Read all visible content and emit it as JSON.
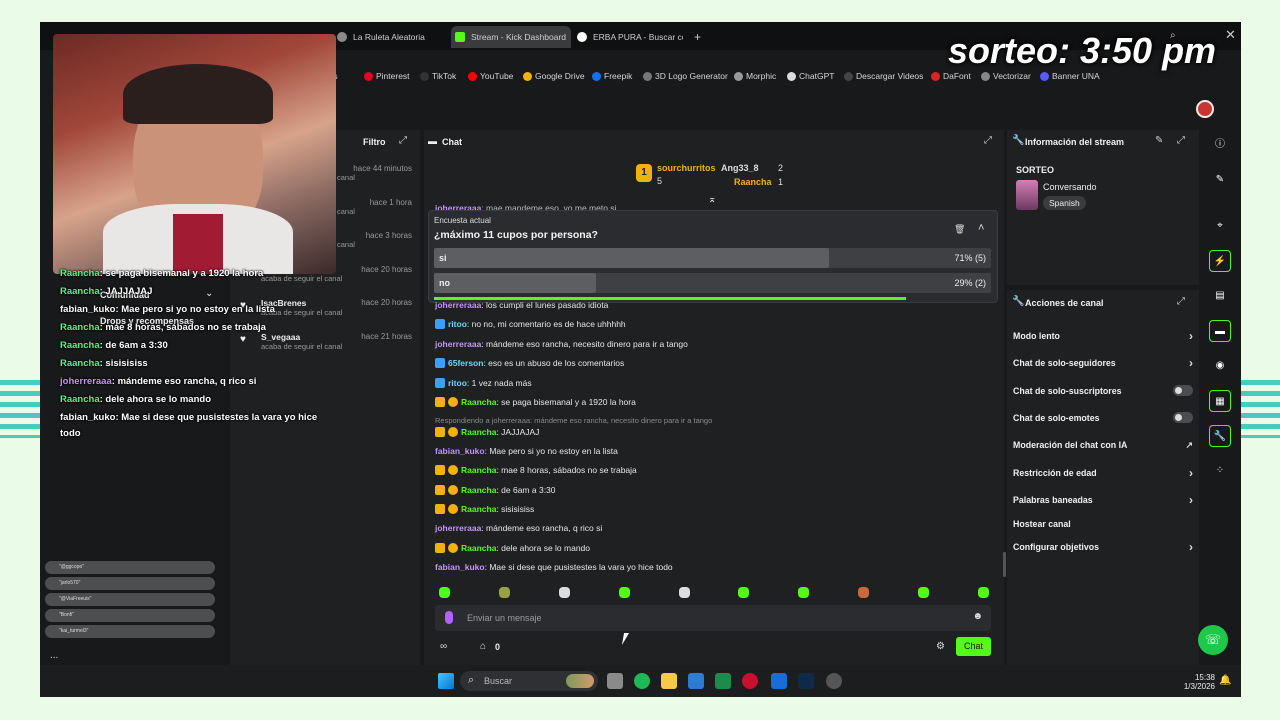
{
  "overlay": {
    "title": "sorteo: 3:50 pm"
  },
  "browser": {
    "tabs": [
      {
        "label": "La Ruleta Aleatoria"
      },
      {
        "label": "Stream - Kick Dashboard"
      },
      {
        "label": "ERBA PURA - Buscar con"
      }
    ],
    "new_tab": "+",
    "bookmarks": [
      "ales",
      "Pinterest",
      "TikTok",
      "YouTube",
      "Google Drive",
      "Freepik",
      "3D Logo Generator",
      "Morphic",
      "ChatGPT",
      "Descargar Videos",
      "DaFont",
      "Vectorizar",
      "Banner UNA"
    ]
  },
  "left_panel": {
    "filter_label": "Filtro",
    "community": "Comunidad",
    "drops": "Drops y recompensas",
    "events": [
      {
        "time": "hace 44 minutos",
        "user": "",
        "action": "canal"
      },
      {
        "time": "hace 1 hora",
        "user": "",
        "action": "canal"
      },
      {
        "time": "hace 3 horas",
        "user": "",
        "action": "canal"
      },
      {
        "time": "hace 20 horas",
        "user": "",
        "action": "acaba de seguir el canal"
      },
      {
        "time": "hace 20 horas",
        "user": "IsacBrenes",
        "action": "acaba de seguir el canal"
      },
      {
        "time": "hace 21 horas",
        "user": "S_vegaaa",
        "action": "acaba de seguir el canal"
      }
    ],
    "overlay_chat": [
      {
        "user": "Raancha",
        "text": ": se paga bisemanal y a 1920 la hora"
      },
      {
        "user": "Raancha",
        "text": ": JAJJAJAJ"
      },
      {
        "user": "fabian_kuko",
        "text": ": Mae pero si yo no estoy en la lista"
      },
      {
        "user": "Raancha",
        "text": ": mae 8 horas, sábados no se trabaja"
      },
      {
        "user": "Raancha",
        "text": ": de 6am a 3:30"
      },
      {
        "user": "Raancha",
        "text": ": sisisisiss"
      },
      {
        "user": "joherreraaa",
        "text": ": mándeme eso rancha, q rico si"
      },
      {
        "user": "Raancha",
        "text": ": dele ahora se lo mando"
      },
      {
        "user": "fabian_kuko",
        "text": ": Mae si dese que pusistestes la vara yo hice"
      },
      {
        "user": "",
        "text": "todo"
      }
    ],
    "giveaway_entries": [
      "\"@ggcopo\"",
      "\"jarlo570\"",
      "\"@ViaFreeuis\"",
      "\"Bonfi\"",
      "\"kai_turmel3\""
    ],
    "more": "..."
  },
  "chat": {
    "title": "Chat",
    "leaderboard": [
      {
        "rank": "1",
        "name": "sourchurritos",
        "count": "5"
      },
      {
        "rank": "",
        "name": "Ang33_8",
        "count": "2"
      },
      {
        "rank": "",
        "name": "Raancha",
        "count": "1"
      }
    ],
    "poll": {
      "heading": "Encuesta actual",
      "question": "¿máximo 11 cupos por persona?",
      "options": [
        {
          "label": "si",
          "result": "71% (5)",
          "percent": 71
        },
        {
          "label": "no",
          "result": "29% (2)",
          "percent": 29
        }
      ]
    },
    "messages": [
      {
        "user": "joherreraaa",
        "text": ": mae mandeme eso, yo me meto si"
      },
      {
        "user": "joherreraaa",
        "text": ": los cumpli el lunes pasado idiota"
      },
      {
        "user": "ritoo",
        "text": ": no no, mi comentario es de hace uhhhhh"
      },
      {
        "user": "joherreraaa",
        "text": ": mándeme eso rancha, necesito dinero para ir a tango"
      },
      {
        "user": "65ferson",
        "text": ": eso es un abuso de los comentarios"
      },
      {
        "user": "ritoo",
        "text": ": 1 vez nada más"
      },
      {
        "user": "Raancha",
        "text": ": se paga bisemanal y a 1920 la hora"
      },
      {
        "user": "",
        "text": "Respondiendo a joherreraaa: mándeme eso rancha, necesito dinero para ir a tango"
      },
      {
        "user": "Raancha",
        "text": ": JAJJAJAJ"
      },
      {
        "user": "fabian_kuko",
        "text": ": Mae pero si yo no estoy en la lista"
      },
      {
        "user": "Raancha",
        "text": ": mae 8 horas, sábados no se trabaja"
      },
      {
        "user": "Raancha",
        "text": ": de 6am a 3:30"
      },
      {
        "user": "Raancha",
        "text": ": sisisisiss"
      },
      {
        "user": "joherreraaa",
        "text": ": mándeme eso rancha, q rico si"
      },
      {
        "user": "Raancha",
        "text": ": dele ahora se lo mando"
      },
      {
        "user": "fabian_kuko",
        "text": ": Mae si dese que pusistestes la vara yo hice todo"
      }
    ],
    "input_placeholder": "Enviar un mensaje",
    "points": "0",
    "send_label": "Chat"
  },
  "stream_info": {
    "title": "Información del stream",
    "stream_title": "SORTEO",
    "category": "Conversando",
    "language": "Spanish"
  },
  "channel_actions": {
    "title": "Acciones de canal",
    "items": [
      {
        "label": "Modo lento",
        "control": "chevron"
      },
      {
        "label": "Chat de solo-seguidores",
        "control": "chevron"
      },
      {
        "label": "Chat de solo-suscriptores",
        "control": "toggle"
      },
      {
        "label": "Chat de solo-emotes",
        "control": "toggle"
      },
      {
        "label": "Moderación del chat con IA",
        "control": "external"
      },
      {
        "label": "Restricción de edad",
        "control": "chevron"
      },
      {
        "label": "Palabras baneadas",
        "control": "chevron"
      },
      {
        "label": "Hostear canal",
        "control": "none"
      },
      {
        "label": "Configurar objetivos",
        "control": "chevron"
      }
    ]
  },
  "taskbar": {
    "search_placeholder": "Buscar",
    "time": "15:38",
    "date": "1/3/2026"
  },
  "colors": {
    "accent": "#53fc18",
    "stripes": "#2bc3b6",
    "panel": "#1f2022"
  }
}
